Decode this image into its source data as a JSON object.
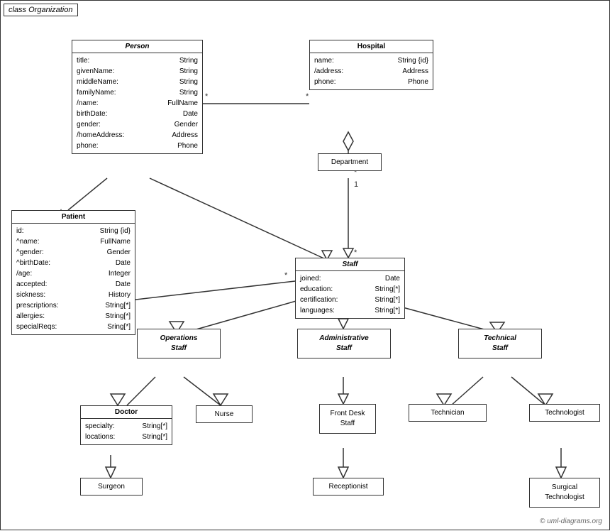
{
  "diagram": {
    "title": "class Organization",
    "classes": {
      "person": {
        "name": "Person",
        "attrs": [
          {
            "name": "title:",
            "type": "String"
          },
          {
            "name": "givenName:",
            "type": "String"
          },
          {
            "name": "middleName:",
            "type": "String"
          },
          {
            "name": "familyName:",
            "type": "String"
          },
          {
            "name": "/name:",
            "type": "FullName"
          },
          {
            "name": "birthDate:",
            "type": "Date"
          },
          {
            "name": "gender:",
            "type": "Gender"
          },
          {
            "name": "/homeAddress:",
            "type": "Address"
          },
          {
            "name": "phone:",
            "type": "Phone"
          }
        ]
      },
      "hospital": {
        "name": "Hospital",
        "attrs": [
          {
            "name": "name:",
            "type": "String {id}"
          },
          {
            "name": "/address:",
            "type": "Address"
          },
          {
            "name": "phone:",
            "type": "Phone"
          }
        ]
      },
      "patient": {
        "name": "Patient",
        "attrs": [
          {
            "name": "id:",
            "type": "String {id}"
          },
          {
            "name": "^name:",
            "type": "FullName"
          },
          {
            "name": "^gender:",
            "type": "Gender"
          },
          {
            "name": "^birthDate:",
            "type": "Date"
          },
          {
            "name": "/age:",
            "type": "Integer"
          },
          {
            "name": "accepted:",
            "type": "Date"
          },
          {
            "name": "sickness:",
            "type": "History"
          },
          {
            "name": "prescriptions:",
            "type": "String[*]"
          },
          {
            "name": "allergies:",
            "type": "String[*]"
          },
          {
            "name": "specialReqs:",
            "type": "Sring[*]"
          }
        ]
      },
      "department": {
        "name": "Department"
      },
      "staff": {
        "name": "Staff",
        "attrs": [
          {
            "name": "joined:",
            "type": "Date"
          },
          {
            "name": "education:",
            "type": "String[*]"
          },
          {
            "name": "certification:",
            "type": "String[*]"
          },
          {
            "name": "languages:",
            "type": "String[*]"
          }
        ]
      },
      "operations_staff": {
        "name": "Operations\nStaff"
      },
      "admin_staff": {
        "name": "Administrative\nStaff"
      },
      "technical_staff": {
        "name": "Technical\nStaff"
      },
      "doctor": {
        "name": "Doctor",
        "attrs": [
          {
            "name": "specialty:",
            "type": "String[*]"
          },
          {
            "name": "locations:",
            "type": "String[*]"
          }
        ]
      },
      "nurse": {
        "name": "Nurse"
      },
      "front_desk": {
        "name": "Front Desk\nStaff"
      },
      "technician": {
        "name": "Technician"
      },
      "technologist": {
        "name": "Technologist"
      },
      "surgeon": {
        "name": "Surgeon"
      },
      "receptionist": {
        "name": "Receptionist"
      },
      "surgical_technologist": {
        "name": "Surgical\nTechnologist"
      }
    },
    "copyright": "© uml-diagrams.org"
  }
}
